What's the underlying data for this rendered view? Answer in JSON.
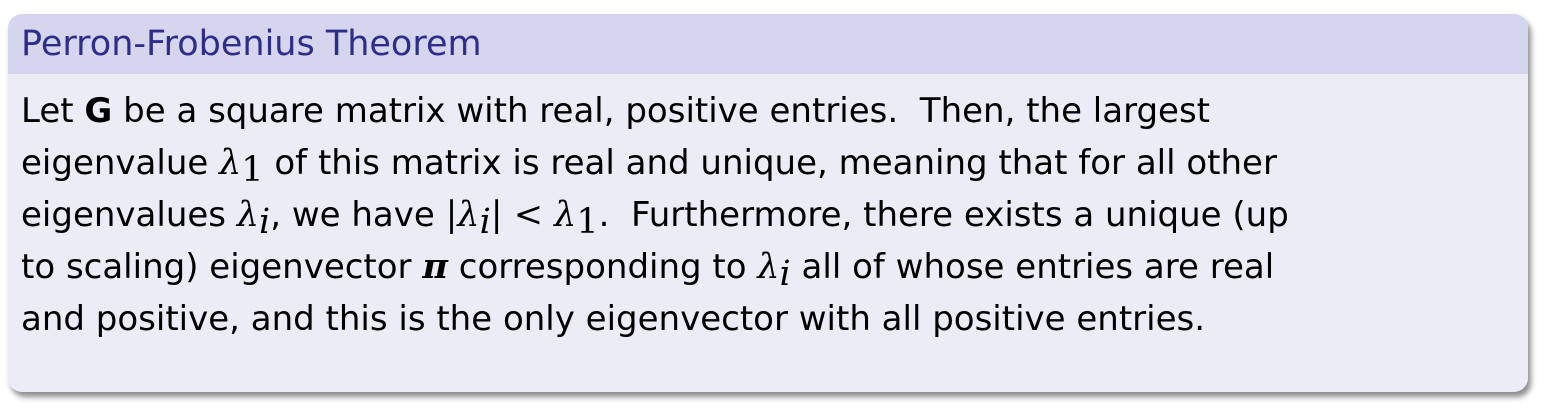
{
  "block": {
    "title": "Perron-Frobenius Theorem",
    "lines": [
      [
        {
          "t": "Let ",
          "s": "text"
        },
        {
          "t": "G",
          "s": "bold"
        },
        {
          "t": " be a square matrix with real, positive entries.  Then, the largest",
          "s": "text"
        }
      ],
      [
        {
          "t": "eigenvalue ",
          "s": "text"
        },
        {
          "t": "λ",
          "s": "math"
        },
        {
          "t": "1",
          "s": "sub"
        },
        {
          "t": " of this matrix is real and unique, meaning that for all other",
          "s": "text"
        }
      ],
      [
        {
          "t": "eigenvalues ",
          "s": "text"
        },
        {
          "t": "λ",
          "s": "math"
        },
        {
          "t": "i",
          "s": "subital"
        },
        {
          "t": ", we have ",
          "s": "text"
        },
        {
          "t": "|",
          "s": "mathup"
        },
        {
          "t": "λ",
          "s": "math"
        },
        {
          "t": "i",
          "s": "subital"
        },
        {
          "t": "| < ",
          "s": "mathup"
        },
        {
          "t": "λ",
          "s": "math"
        },
        {
          "t": "1",
          "s": "sub"
        },
        {
          "t": ".  Furthermore, there exists a unique (up",
          "s": "text"
        }
      ],
      [
        {
          "t": "to scaling) eigenvector ",
          "s": "text"
        },
        {
          "t": "π",
          "s": "boldital"
        },
        {
          "t": " corresponding to ",
          "s": "text"
        },
        {
          "t": "λ",
          "s": "math"
        },
        {
          "t": "i",
          "s": "subital"
        },
        {
          "t": " all of whose entries are real",
          "s": "text"
        }
      ],
      [
        {
          "t": "and positive, and this is the only eigenvector with all positive entries.",
          "s": "text"
        }
      ]
    ]
  }
}
